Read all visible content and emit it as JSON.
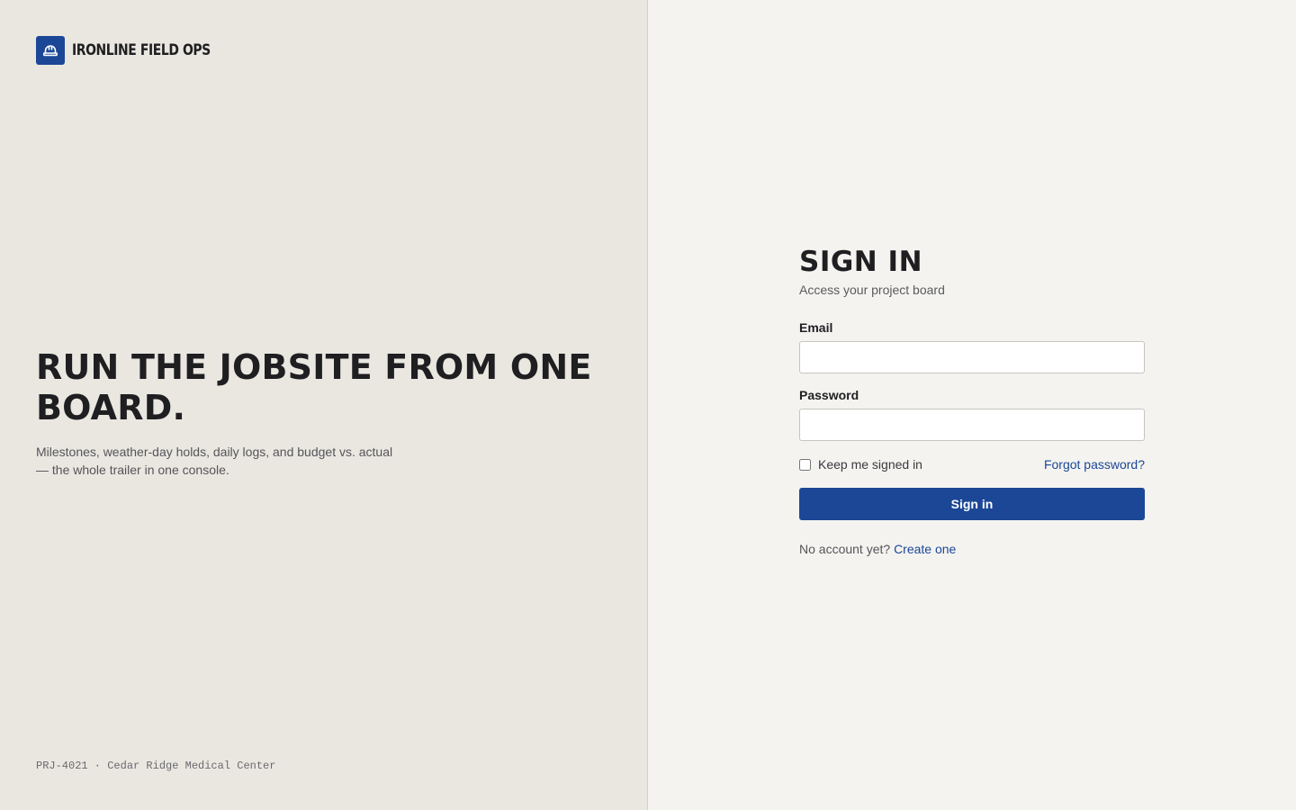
{
  "brand": {
    "name": "IRONLINE FIELD OPS",
    "icon": "hard-hat-icon",
    "color": "#1b4796"
  },
  "hero": {
    "title": "RUN THE JOBSITE FROM ONE BOARD.",
    "subtitle": "Milestones, weather-day holds, daily logs, and budget vs. actual — the whole trailer in one console.",
    "project_ref": "PRJ-4021 · Cedar Ridge Medical Center"
  },
  "signin": {
    "title": "SIGN IN",
    "subtitle": "Access your project board",
    "email": {
      "label": "Email",
      "value": "",
      "placeholder": ""
    },
    "password": {
      "label": "Password",
      "value": "",
      "placeholder": ""
    },
    "remember": {
      "label": "Keep me signed in",
      "checked": false
    },
    "forgot_label": "Forgot password?",
    "submit_label": "Sign in",
    "signup_prompt": "No account yet?",
    "signup_link": "Create one"
  },
  "colors": {
    "accent": "#1b4796",
    "hero_bg": "#eae7e1",
    "panel_bg": "#f4f3f0"
  }
}
